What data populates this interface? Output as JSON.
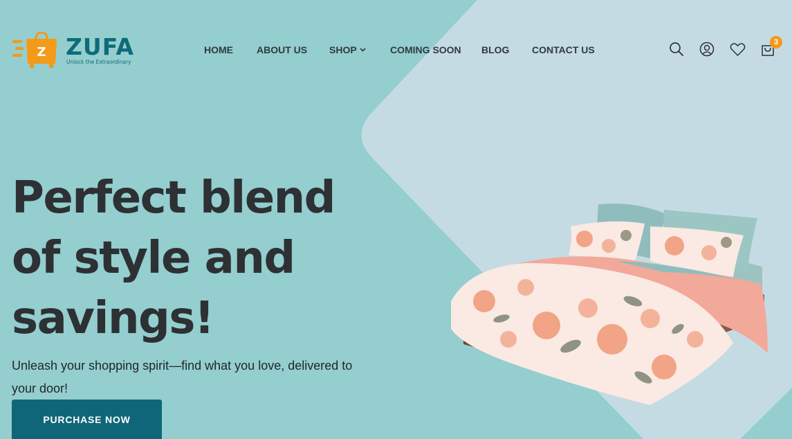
{
  "brand": {
    "name": "ZUFA",
    "tagline": "Unlock the Extraordinary",
    "mark_letter": "Z",
    "primary_color": "#0f6b78",
    "accent_color": "#f39a18"
  },
  "nav": {
    "items": [
      {
        "label": "HOME"
      },
      {
        "label": "ABOUT US"
      },
      {
        "label": "SHOP",
        "has_dropdown": true
      },
      {
        "label": "COMING SOON"
      },
      {
        "label": "BLOG"
      },
      {
        "label": "CONTACT US"
      }
    ]
  },
  "header_icons": {
    "search": "search-icon",
    "account": "user-icon",
    "wishlist": "heart-icon",
    "cart": "cart-icon",
    "cart_count": "3"
  },
  "hero": {
    "title_lines": [
      "Perfect blend",
      "of style and",
      "savings!"
    ],
    "subtitle": "Unleash your shopping spirit—find what you love, delivered to your door!",
    "cta_label": "PURCHASE NOW",
    "image": "bed-with-floral-bedding",
    "colors": {
      "background": "#94cecf",
      "diamond": "#c5dbe4",
      "title": "#2d3133",
      "cta": "#0f6678"
    }
  }
}
